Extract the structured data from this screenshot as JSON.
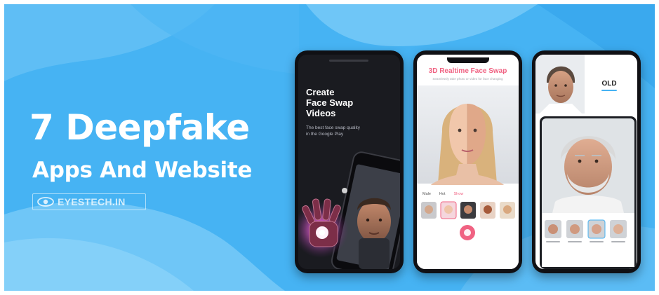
{
  "headline": {
    "line1": "7 Deepfake",
    "line2": "Apps And Website"
  },
  "brand": {
    "name": "EYESTECH.IN",
    "icon": "eye-icon"
  },
  "phone1": {
    "title": "Create\nFace Swap\nVideos",
    "subtitle": "The best face swap quality\nin the Google Play"
  },
  "phone2": {
    "title": "3D Realtime Face Swap",
    "subtitle": "Seamlessly take photo or video for face changing",
    "filters": [
      "Male",
      "Hot",
      "Show"
    ]
  },
  "phone3": {
    "label": "OLD"
  },
  "colors": {
    "background": "#46b3f3",
    "wave_light": "#6fc6f7",
    "wave_dark": "#2f9de6",
    "accent_pink": "#f06282",
    "phone_body": "#101014"
  }
}
